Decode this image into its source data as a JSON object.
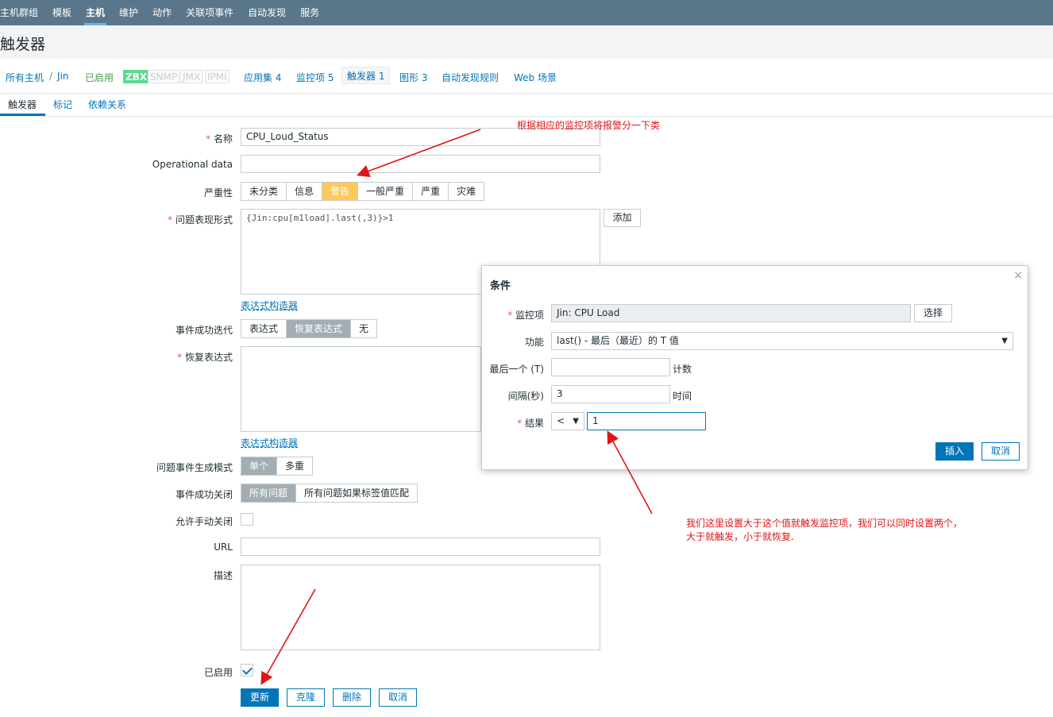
{
  "topnav": [
    "主机群组",
    "模板",
    "主机",
    "维护",
    "动作",
    "关联项事件",
    "自动发现",
    "服务"
  ],
  "page_title": "触发器",
  "hostbar": {
    "all_hosts": "所有主机",
    "sep": "/",
    "host": "Jin",
    "enabled": "已启用",
    "tags": [
      "ZBX",
      "SNMP",
      "JMX",
      "IPMI"
    ],
    "links": [
      "应用集 4",
      "监控项 5",
      "触发器 1",
      "图形 3",
      "自动发现规则",
      "Web 场景"
    ]
  },
  "subtabs": [
    "触发器",
    "标记",
    "依赖关系"
  ],
  "form": {
    "name_label": "名称",
    "name_value": "CPU_Loud_Status",
    "opdata_label": "Operational data",
    "severity_label": "严重性",
    "severities": [
      "未分类",
      "信息",
      "警告",
      "一般严重",
      "严重",
      "灾难"
    ],
    "expr_label": "问题表现形式",
    "expr_value": "{Jin:cpu[m1load].last(,3)}>1",
    "add_btn": "添加",
    "expr_builder": "表达式构造器",
    "ok_event_label": "事件成功迭代",
    "ok_event_options": [
      "表达式",
      "恢复表达式",
      "无"
    ],
    "recovery_label": "恢复表达式",
    "recovery_builder": "表达式构造器",
    "gen_mode_label": "问题事件生成模式",
    "gen_mode_options": [
      "单个",
      "多重"
    ],
    "ok_close_label": "事件成功关闭",
    "ok_close_options": [
      "所有问题",
      "所有问题如果标签值匹配"
    ],
    "manual_close_label": "允许手动关闭",
    "url_label": "URL",
    "desc_label": "描述",
    "enabled_label": "已启用",
    "buttons": [
      "更新",
      "克隆",
      "删除",
      "取消"
    ]
  },
  "dialog": {
    "title": "条件",
    "close": "×",
    "item_label": "监控项",
    "item_value": "Jin: CPU Load",
    "select_btn": "选择",
    "function_label": "功能",
    "function_value": "last() - 最后（最近）的 T 值",
    "last_label": "最后一个 (T)",
    "last_unit": "计数",
    "interval_label": "间隔(秒)",
    "interval_value": "3",
    "interval_unit": "时间",
    "result_label": "结果",
    "result_op": "<",
    "result_value": "1",
    "insert_btn": "插入",
    "cancel_btn": "取消"
  },
  "annotations": {
    "a1": "根据相应的监控项将报警分一下类",
    "a2_line1": "我们这里设置大于这个值就触发监控项，我们可以同时设置两个，",
    "a2_line2": "大于就触发，小于就恢复."
  },
  "colors": {
    "nav": "#59768a",
    "link": "#0275b8",
    "warning": "#ffc859",
    "annotation": "#e01515"
  }
}
